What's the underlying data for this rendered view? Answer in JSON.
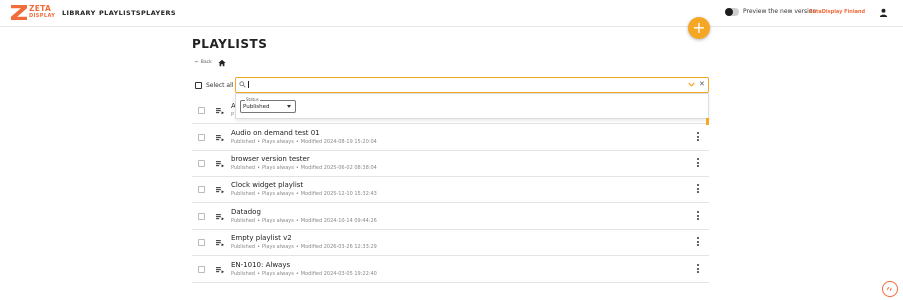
{
  "header": {
    "logo_line1": "ZETA",
    "logo_line2": "DISPLAY",
    "nav": [
      "LIBRARY",
      "PLAYLISTS",
      "PLAYERS"
    ],
    "preview_label": "Preview the new version",
    "tenant": "ZetaDisplay Finland",
    "colors": {
      "brand": "#f26b3a",
      "accent": "#f5a623"
    }
  },
  "page": {
    "title": "PLAYLISTS",
    "back_label": "Back"
  },
  "toolbar": {
    "select_all_label": "Select all",
    "search_value": "",
    "filter": {
      "status_legend": "Status",
      "status_value": "Published"
    }
  },
  "playlists": [
    {
      "title": "A",
      "meta": "P"
    },
    {
      "title": "Audio on demand test 01",
      "status": "Published",
      "plays": "Plays always",
      "modified": "Modified 2024-08-19 15:20:04"
    },
    {
      "title": "browser version tester",
      "status": "Published",
      "plays": "Plays always",
      "modified": "Modified 2025-06-02 08:38:04"
    },
    {
      "title": "Clock widget playlist",
      "status": "Published",
      "plays": "Plays always",
      "modified": "Modified 2025-12-10 15:32:43"
    },
    {
      "title": "Datadog",
      "status": "Published",
      "plays": "Plays always",
      "modified": "Modified 2024-10-14 09:44:26"
    },
    {
      "title": "Empty playlist v2",
      "status": "Published",
      "plays": "Plays always",
      "modified": "Modified 2026-03-26 12:33:29"
    },
    {
      "title": "EN-1010: Always",
      "status": "Published",
      "plays": "Plays always",
      "modified": "Modified 2024-03-05 19:22:40"
    }
  ]
}
